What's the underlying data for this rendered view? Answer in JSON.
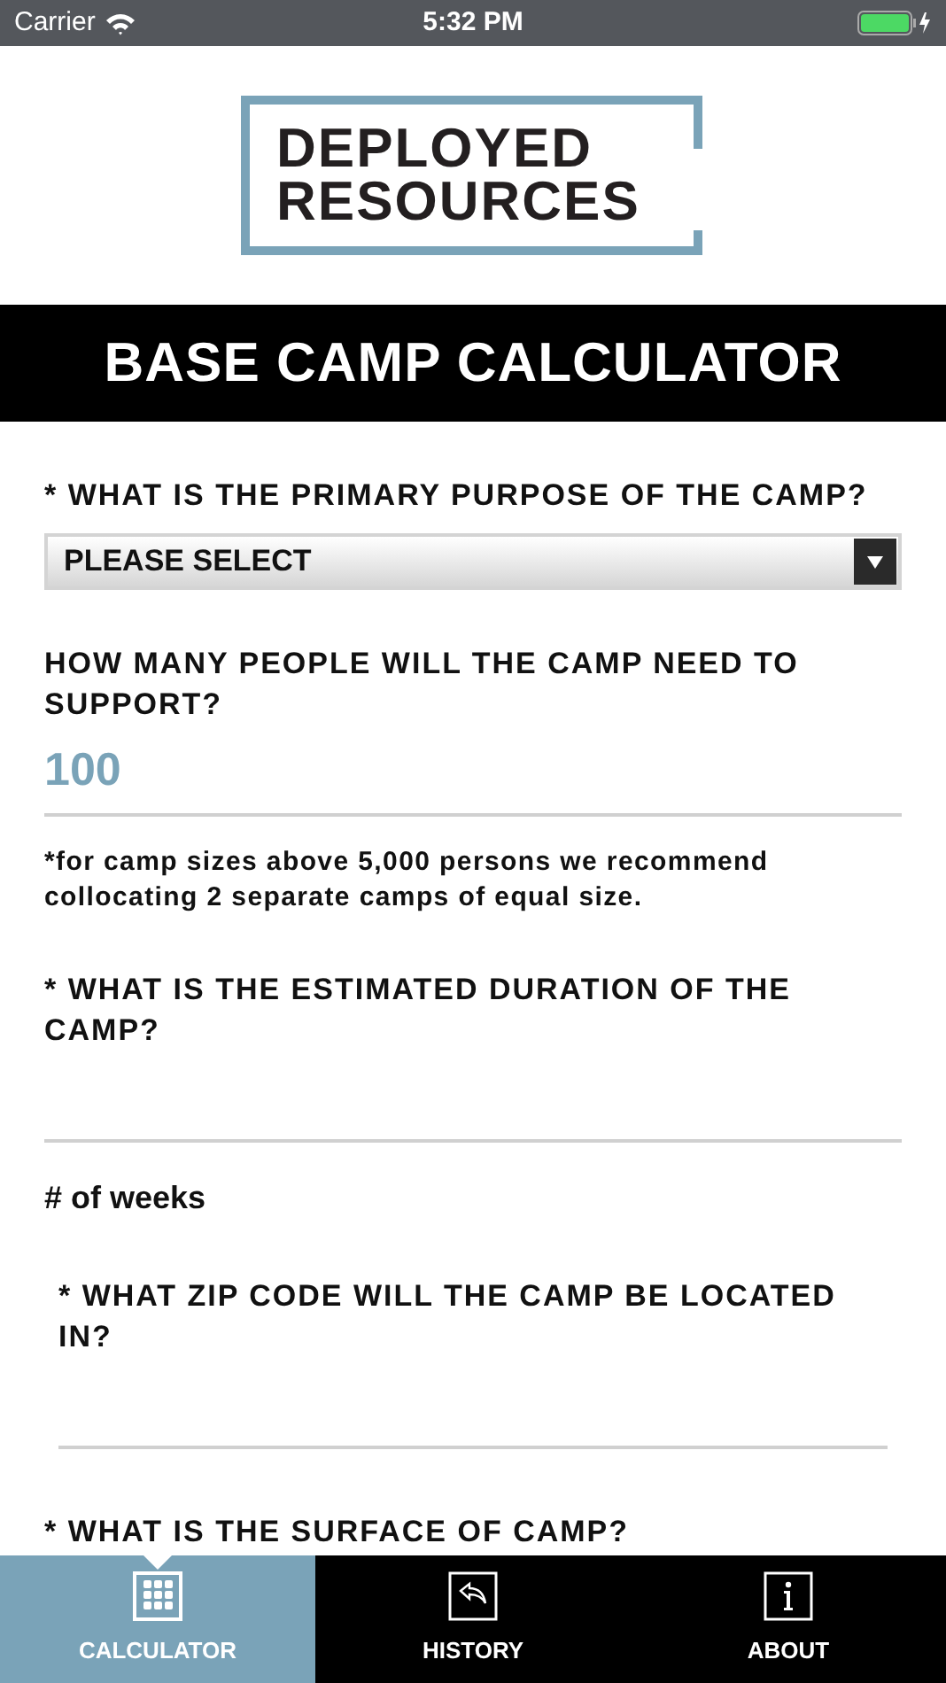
{
  "status_bar": {
    "carrier": "Carrier",
    "time": "5:32 PM"
  },
  "logo": {
    "line_1": "DEPLOYED",
    "line_2": "RESOURCES"
  },
  "title": "BASE CAMP CALCULATOR",
  "form": [
    {
      "kind": "select",
      "label": "* WHAT IS THE PRIMARY PURPOSE OF THE CAMP?",
      "value": "PLEASE SELECT"
    },
    {
      "kind": "input",
      "label": "HOW MANY PEOPLE WILL THE CAMP NEED TO SUPPORT?",
      "value": "100",
      "note": "*for camp sizes above 5,000 persons we recommend collocating 2 separate camps of equal size."
    },
    {
      "kind": "input",
      "label": "* WHAT IS THE ESTIMATED DURATION OF THE CAMP?",
      "note_heading": "# of weeks"
    },
    {
      "kind": "input",
      "label": "* WHAT ZIP CODE WILL THE CAMP BE LOCATED IN?",
      "indented": true
    },
    {
      "kind": "heading",
      "label": "* WHAT IS THE SURFACE OF CAMP?"
    }
  ],
  "tabs": [
    {
      "label": "CALCULATOR",
      "selected": true
    },
    {
      "label": "HISTORY",
      "selected": false
    },
    {
      "label": "ABOUT",
      "selected": false
    }
  ]
}
